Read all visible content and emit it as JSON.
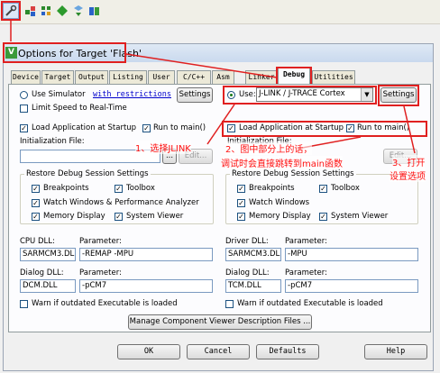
{
  "toolbar": {
    "icons": [
      "target-options-icon",
      "component-icon",
      "manage-icon",
      "download-icon",
      "settings-dropdown-icon",
      "books-icon"
    ]
  },
  "dialog": {
    "title": "Options for Target 'Flash'"
  },
  "tabs": [
    "Device",
    "Target",
    "Output",
    "Listing",
    "User",
    "C/C++",
    "Asm",
    "Linker",
    "Debug",
    "Utilities"
  ],
  "left": {
    "use_simulator": "Use Simulator",
    "with_restrictions": "with restrictions",
    "settings": "Settings",
    "limit_speed": "Limit Speed to Real-Time",
    "load_app": "Load Application at Startup",
    "run_to_main": "Run to main()",
    "init_file_label": "Initialization File:",
    "browse": "...",
    "edit": "Edit...",
    "restore_title": "Restore Debug Session Settings",
    "breakpoints": "Breakpoints",
    "toolbox": "Toolbox",
    "watch_windows": "Watch Windows & Performance Analyzer",
    "memory_display": "Memory Display",
    "system_viewer": "System Viewer",
    "cpu_dll_label": "CPU DLL:",
    "param_label": "Parameter:",
    "cpu_dll": "SARMCM3.DLL",
    "cpu_param": "-REMAP -MPU",
    "dialog_dll_label": "Dialog DLL:",
    "dialog_dll": "DCM.DLL",
    "dialog_param": "-pCM7",
    "warn": "Warn if outdated Executable is loaded"
  },
  "right": {
    "use": "Use:",
    "driver": "J-LINK / J-TRACE Cortex",
    "settings": "Settings",
    "load_app": "Load Application at Startup",
    "run_to_main": "Run to main()",
    "init_file_label": "Initialization File:",
    "edit": "Edit...",
    "restore_title": "Restore Debug Session Settings",
    "breakpoints": "Breakpoints",
    "toolbox": "Toolbox",
    "watch_windows": "Watch Windows",
    "memory_display": "Memory Display",
    "system_viewer": "System Viewer",
    "driver_dll_label": "Driver DLL:",
    "param_label": "Parameter:",
    "driver_dll": "SARMCM3.DLL",
    "driver_param": "-MPU",
    "dialog_dll_label": "Dialog DLL:",
    "dialog_dll": "TCM.DLL",
    "dialog_param": "-pCM7",
    "warn": "Warn if outdated Executable is loaded"
  },
  "manage_button": "Manage Component Viewer Description Files ...",
  "footer": {
    "ok": "OK",
    "cancel": "Cancel",
    "defaults": "Defaults",
    "help": "Help"
  },
  "annotations": {
    "a1": "1、选择JLINK",
    "a2_line1": "2、图中部分上的话，",
    "a2_line2": "调试时会直接跳转到main函数",
    "a3_line1": "3、打开",
    "a3_line2": "设置选项"
  },
  "colors": {
    "annotation": "#ff1010",
    "title_bar": "#c9d9ee",
    "link": "#0000cc"
  }
}
